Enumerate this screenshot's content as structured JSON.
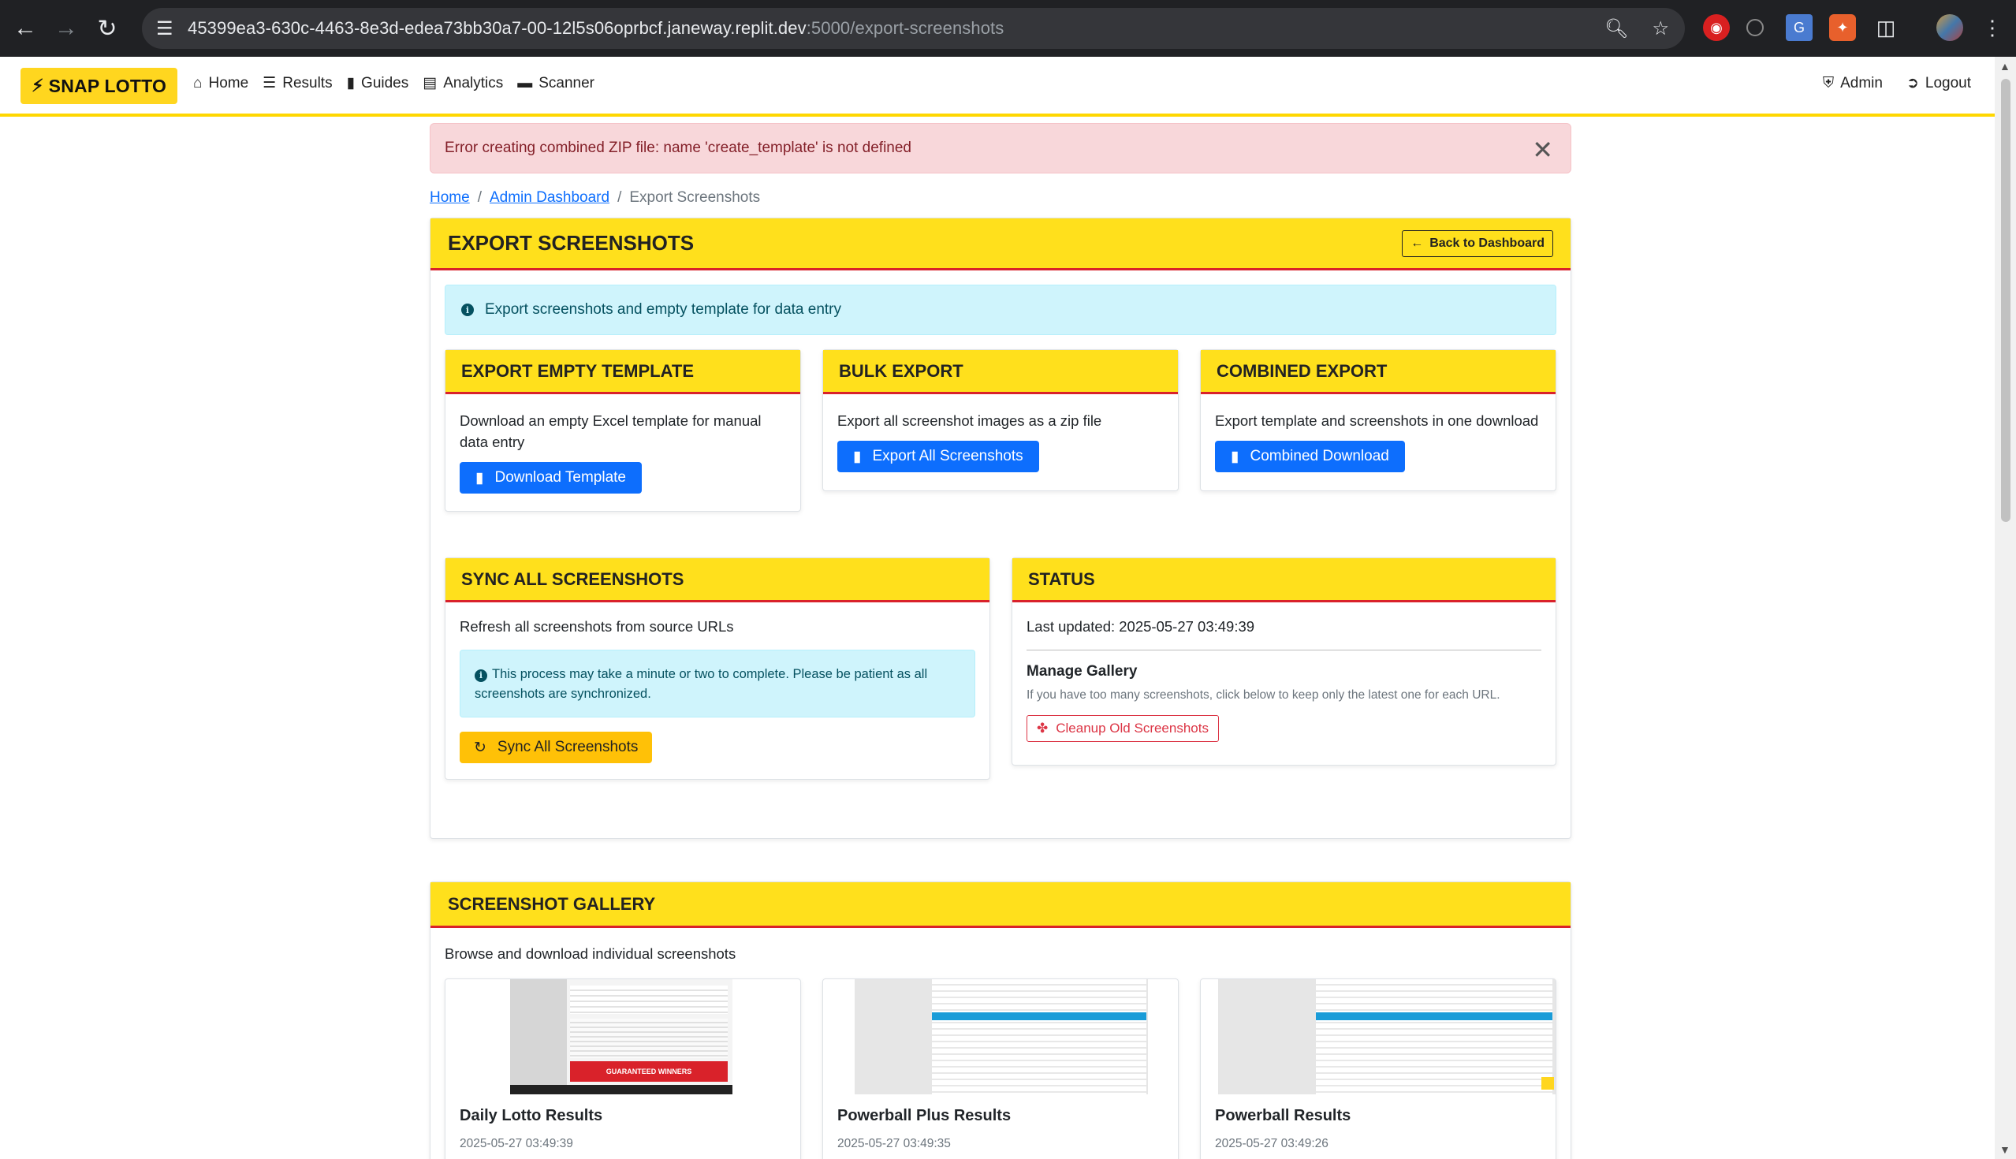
{
  "browser": {
    "url_host": "45399ea3-630c-4463-8e3d-edea73bb30a7-00-12l5s06oprbcf.janeway.replit.dev",
    "url_path": ":5000/export-screenshots",
    "icons": [
      "back-icon",
      "forward-icon",
      "reload-icon",
      "site-settings-icon",
      "zoom-icon",
      "bookmark-star-icon",
      "extensions-icon",
      "profile-avatar",
      "menu-icon"
    ]
  },
  "nav": {
    "brand": "SNAP LOTTO",
    "links": [
      {
        "label": "Home",
        "icon": "house-icon"
      },
      {
        "label": "Results",
        "icon": "list-icon"
      },
      {
        "label": "Guides",
        "icon": "book-icon"
      },
      {
        "label": "Analytics",
        "icon": "chart-icon"
      },
      {
        "label": "Scanner",
        "icon": "scanner-icon"
      }
    ],
    "right": [
      {
        "label": "Admin",
        "icon": "shield-icon"
      },
      {
        "label": "Logout",
        "icon": "logout-icon"
      }
    ]
  },
  "alert": {
    "message": "Error creating combined ZIP file: name 'create_template' is not defined"
  },
  "breadcrumb": {
    "home": "Home",
    "dashboard": "Admin Dashboard",
    "current": "Export Screenshots",
    "sep": "/"
  },
  "main": {
    "title": "EXPORT SCREENSHOTS",
    "back_button": "Back to Dashboard",
    "info": "Export screenshots and empty template for data entry"
  },
  "cards": {
    "template": {
      "title": "EXPORT EMPTY TEMPLATE",
      "desc": "Download an empty Excel template for manual data entry",
      "button": "Download Template"
    },
    "bulk": {
      "title": "BULK EXPORT",
      "desc": "Export all screenshot images as a zip file",
      "button": "Export All Screenshots"
    },
    "combined": {
      "title": "COMBINED EXPORT",
      "desc": "Export template and screenshots in one download",
      "button": "Combined Download"
    },
    "sync": {
      "title": "SYNC ALL SCREENSHOTS",
      "desc": "Refresh all screenshots from source URLs",
      "note": "This process may take a minute or two to complete. Please be patient as all screenshots are synchronized.",
      "button": "Sync All Screenshots"
    },
    "status": {
      "title": "STATUS",
      "updated": "Last updated: 2025-05-27 03:49:39",
      "gallery_heading": "Manage Gallery",
      "gallery_desc": "If you have too many screenshots, click below to keep only the latest one for each URL.",
      "button": "Cleanup Old Screenshots"
    }
  },
  "gallery": {
    "title": "SCREENSHOT GALLERY",
    "desc": "Browse and download individual screenshots",
    "items": [
      {
        "name": "Daily Lotto Results",
        "date": "2025-05-27 03:49:39"
      },
      {
        "name": "Powerball Plus Results",
        "date": "2025-05-27 03:49:35"
      },
      {
        "name": "Powerball Results",
        "date": "2025-05-27 03:49:26"
      }
    ],
    "thumb_banner": "GUARANTEED WINNERS"
  },
  "colors": {
    "brand_yellow": "#ffd61f",
    "header_yellow": "#ffe01c",
    "accent_red": "#d9222a",
    "primary_blue": "#0d6efd",
    "warning": "#ffc107"
  }
}
